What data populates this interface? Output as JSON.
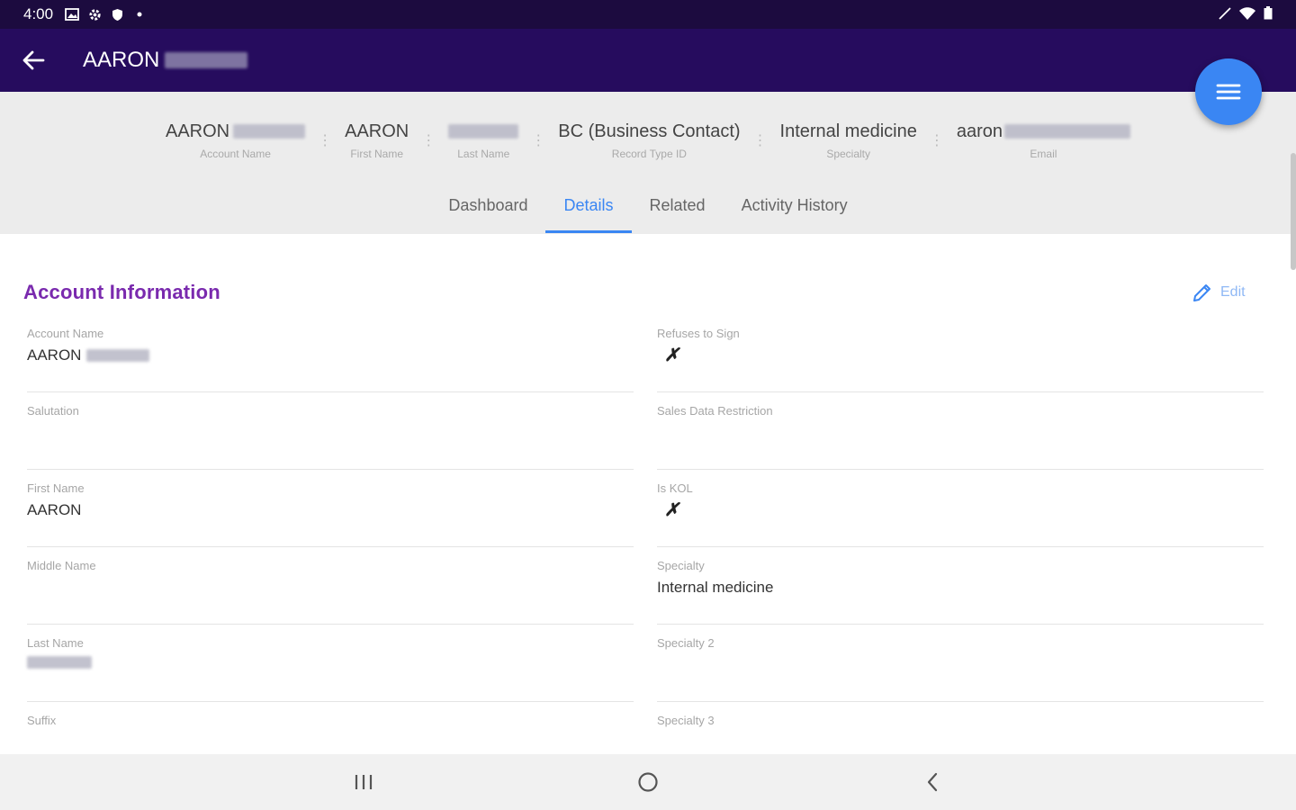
{
  "status_bar": {
    "time": "4:00",
    "icons": [
      "gallery-icon",
      "settings-icon",
      "shield-icon",
      "dot-icon"
    ],
    "right_icons": [
      "signal-icon",
      "wifi-icon",
      "battery-icon"
    ]
  },
  "app_bar": {
    "title_first": "AARON",
    "title_redacted": true
  },
  "summary": [
    {
      "value": "AARON",
      "label": "Account Name",
      "redacted_suffix": true
    },
    {
      "value": "AARON",
      "label": "First Name",
      "redacted_suffix": false
    },
    {
      "value": "",
      "label": "Last Name",
      "redacted_suffix": true
    },
    {
      "value": "BC (Business Contact)",
      "label": "Record Type ID",
      "redacted_suffix": false
    },
    {
      "value": "Internal medicine",
      "label": "Specialty",
      "redacted_suffix": false
    },
    {
      "value": "aaron",
      "label": "Email",
      "redacted_suffix": true
    }
  ],
  "tabs": [
    {
      "label": "Dashboard",
      "active": false
    },
    {
      "label": "Details",
      "active": true
    },
    {
      "label": "Related",
      "active": false
    },
    {
      "label": "Activity History",
      "active": false
    }
  ],
  "section": {
    "title": "Account Information",
    "edit_label": "Edit"
  },
  "left_fields": [
    {
      "label": "Account Name",
      "value": "AARON",
      "redacted": true
    },
    {
      "label": "Salutation",
      "value": ""
    },
    {
      "label": "First Name",
      "value": "AARON"
    },
    {
      "label": "Middle Name",
      "value": ""
    },
    {
      "label": "Last Name",
      "value": "",
      "redacted": true
    },
    {
      "label": "Suffix",
      "value": ""
    }
  ],
  "right_fields": [
    {
      "label": "Refuses to Sign",
      "value": "✗"
    },
    {
      "label": "Sales Data Restriction",
      "value": ""
    },
    {
      "label": "Is KOL",
      "value": "✗"
    },
    {
      "label": "Specialty",
      "value": "Internal medicine"
    },
    {
      "label": "Specialty 2",
      "value": ""
    },
    {
      "label": "Specialty 3",
      "value": ""
    }
  ],
  "colors": {
    "status_bar": "#1c0b3f",
    "app_bar": "#260c5e",
    "accent": "#3a86f3",
    "section_title": "#7a2aae"
  }
}
